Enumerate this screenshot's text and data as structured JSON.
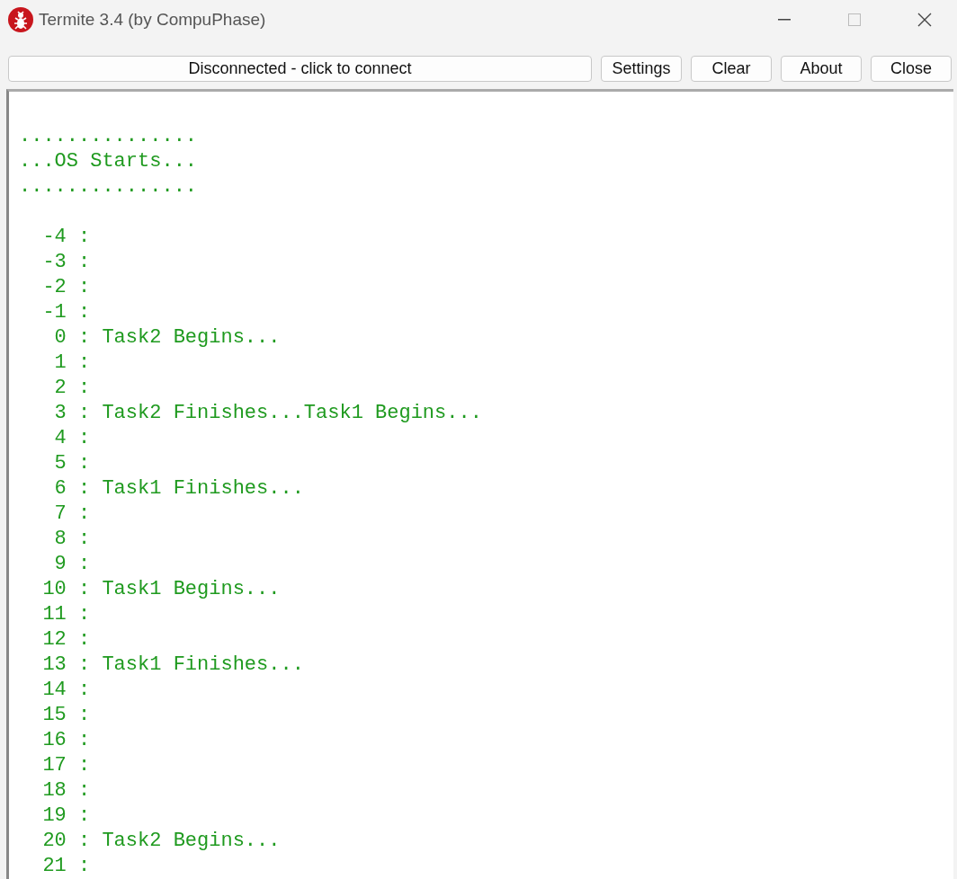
{
  "window": {
    "title": "Termite 3.4 (by CompuPhase)"
  },
  "toolbar": {
    "connection": "Disconnected - click to connect",
    "buttons": [
      "Settings",
      "Clear",
      "About",
      "Close"
    ]
  },
  "terminal": {
    "header_lines": [
      "...............",
      "...OS Starts...",
      "..............."
    ],
    "counter_lines": [
      "  -4 :",
      "  -3 :",
      "  -2 :",
      "  -1 :",
      "   0 : Task2 Begins...",
      "   1 :",
      "   2 :",
      "   3 : Task2 Finishes...Task1 Begins...",
      "   4 :",
      "   5 :",
      "   6 : Task1 Finishes...",
      "   7 :",
      "   8 :",
      "   9 :",
      "  10 : Task1 Begins...",
      "  11 :",
      "  12 :",
      "  13 : Task1 Finishes...",
      "  14 :",
      "  15 :",
      "  16 :",
      "  17 :",
      "  18 :",
      "  19 :",
      "  20 : Task2 Begins...",
      "  21 :"
    ]
  }
}
